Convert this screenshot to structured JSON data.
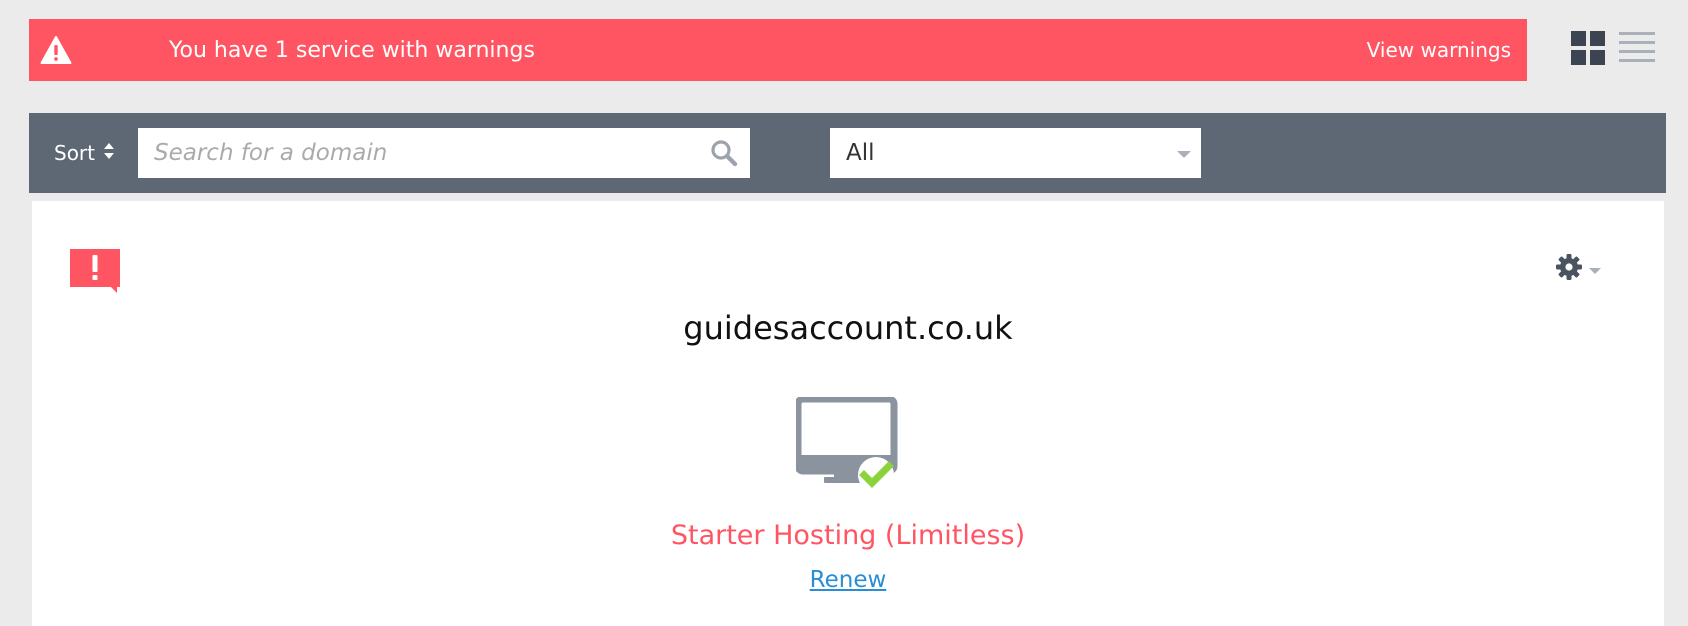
{
  "banner": {
    "message": "You have 1 service with warnings",
    "view_label": "View warnings",
    "color": "#ff5563"
  },
  "toolbar": {
    "sort_label": "Sort",
    "search": {
      "placeholder": "Search for a domain",
      "value": ""
    },
    "filter": {
      "selected": "All"
    },
    "color": "#5e6875"
  },
  "service": {
    "domain": "guidesaccount.co.uk",
    "plan": "Starter Hosting (Limitless)",
    "renew_label": "Renew",
    "status_icon": "monitor-check-icon",
    "alert_icon": "exclamation-badge-icon"
  },
  "colors": {
    "accent_red": "#ff5563",
    "link_blue": "#2a8ed6",
    "check_green": "#8cd23c",
    "icon_gray": "#8a939e"
  }
}
